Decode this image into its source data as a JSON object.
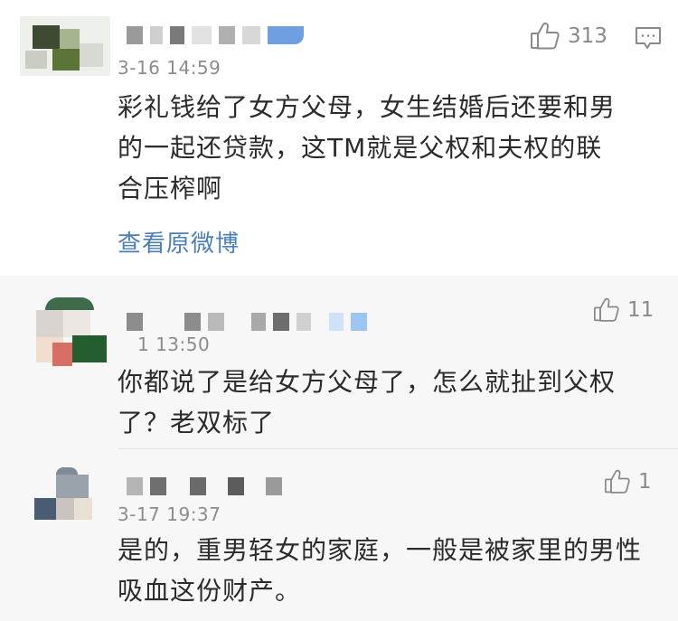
{
  "main_comment": {
    "time": "3-16 14:59",
    "likes": "313",
    "text_lines": [
      "彩礼钱给了女方父母，女生结婚后还要和男",
      "的一起还贷款，这TM就是父权和夫权的联",
      "合压榨啊"
    ],
    "view_original_label": "查看原微博"
  },
  "replies": [
    {
      "time": "1 13:50",
      "likes": "11",
      "text_lines": [
        "你都说了是给女方父母了，怎么就扯到父权",
        "了？老双标了"
      ]
    },
    {
      "time": "3-17 19:37",
      "likes": "1",
      "text_lines": [
        "是的，重男轻女的家庭，一般是被家里的男性",
        "吸血这份财产。"
      ]
    }
  ],
  "icons": {
    "like": "thumbs-up-icon",
    "comment": "comment-icon"
  },
  "colors": {
    "link": "#4b7fb8",
    "meta": "#8a8a8a",
    "text": "#2b2b2b"
  }
}
